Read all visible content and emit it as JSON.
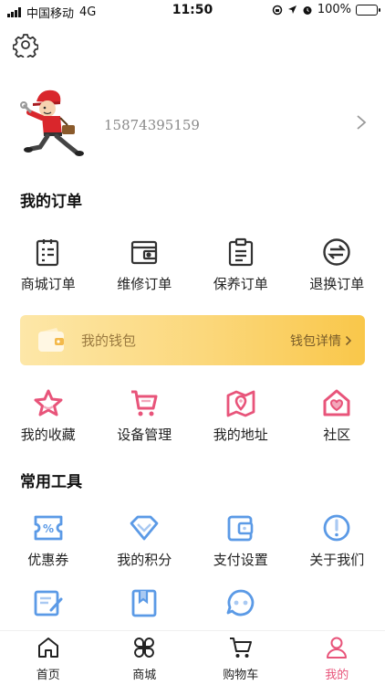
{
  "status_bar": {
    "carrier": "中国移动",
    "network": "4G",
    "time": "11:50",
    "battery": "100%"
  },
  "profile": {
    "phone": "15874395159"
  },
  "orders": {
    "title": "我的订单",
    "items": [
      {
        "label": "商城订单",
        "icon": "mall-order-icon"
      },
      {
        "label": "维修订单",
        "icon": "repair-order-icon"
      },
      {
        "label": "保养订单",
        "icon": "maintenance-order-icon"
      },
      {
        "label": "退换订单",
        "icon": "exchange-order-icon"
      }
    ]
  },
  "wallet": {
    "title": "我的钱包",
    "detail": "钱包详情"
  },
  "shortcuts": [
    {
      "label": "我的收藏",
      "icon": "star-icon"
    },
    {
      "label": "设备管理",
      "icon": "cart-device-icon"
    },
    {
      "label": "我的地址",
      "icon": "map-icon"
    },
    {
      "label": "社区",
      "icon": "home-heart-icon"
    }
  ],
  "tools": {
    "title": "常用工具",
    "row1": [
      {
        "label": "优惠券",
        "icon": "coupon-icon"
      },
      {
        "label": "我的积分",
        "icon": "diamond-icon"
      },
      {
        "label": "支付设置",
        "icon": "wallet-pay-icon"
      },
      {
        "label": "关于我们",
        "icon": "info-icon"
      }
    ],
    "row2": [
      {
        "label": "",
        "icon": "edit-note-icon"
      },
      {
        "label": "",
        "icon": "bookmark-book-icon"
      },
      {
        "label": "",
        "icon": "chat-bubble-icon"
      }
    ]
  },
  "tabbar": [
    {
      "label": "首页",
      "icon": "home-icon"
    },
    {
      "label": "商城",
      "icon": "clover-icon"
    },
    {
      "label": "购物车",
      "icon": "cart-icon"
    },
    {
      "label": "我的",
      "icon": "user-icon",
      "active": true
    }
  ],
  "colors": {
    "accent": "#e8547a",
    "tool_blue": "#5b9ae6",
    "wallet_start": "#fde7a8",
    "wallet_end": "#f9c74a"
  }
}
